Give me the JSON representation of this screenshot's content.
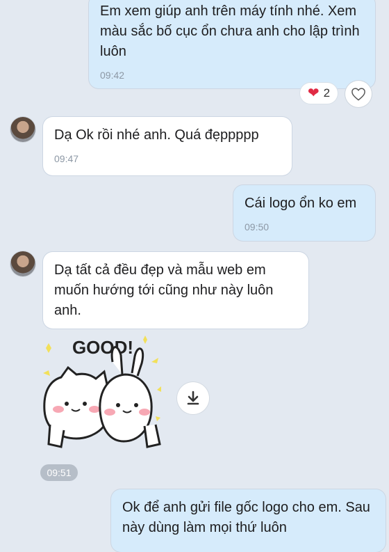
{
  "messages": [
    {
      "text": "Em xem giúp anh trên máy tính nhé. Xem màu sắc bố cục ổn chưa anh cho lập trình luôn",
      "time": "09:42",
      "direction": "outgoing"
    },
    {
      "text": "Dạ Ok rồi nhé anh. Quá đẹppppp",
      "time": "09:47",
      "direction": "incoming"
    },
    {
      "text": "Cái logo ổn ko em",
      "time": "09:50",
      "direction": "outgoing"
    },
    {
      "text": "Dạ tất cả đều đẹp và mẫu web em muốn hướng tới cũng như này luôn anh.",
      "time": "",
      "direction": "incoming"
    },
    {
      "text": "Ok để anh gửi file gốc logo cho em. Sau này dùng làm mọi thứ luôn",
      "time": "",
      "direction": "outgoing"
    }
  ],
  "reaction": {
    "emoji_icon": "heart-icon",
    "count": "2"
  },
  "sticker": {
    "text": "GOOD!",
    "time": "09:51"
  },
  "colors": {
    "background": "#e3e9f1",
    "outgoing_bubble": "#d6ebfb",
    "incoming_bubble": "#ffffff",
    "heart": "#e02a44",
    "timestamp": "#8d98a5"
  }
}
